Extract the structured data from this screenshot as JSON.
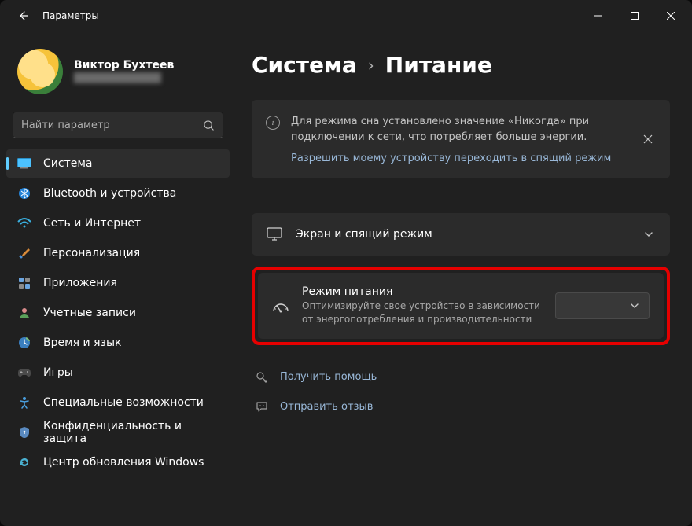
{
  "window": {
    "title": "Параметры"
  },
  "profile": {
    "name": "Виктор Бухтеев",
    "email": "████████████"
  },
  "search": {
    "placeholder": "Найти параметр"
  },
  "sidebar": {
    "items": [
      {
        "label": "Система",
        "icon": "system"
      },
      {
        "label": "Bluetooth и устройства",
        "icon": "bluetooth"
      },
      {
        "label": "Сеть и Интернет",
        "icon": "wifi"
      },
      {
        "label": "Персонализация",
        "icon": "brush"
      },
      {
        "label": "Приложения",
        "icon": "apps"
      },
      {
        "label": "Учетные записи",
        "icon": "account"
      },
      {
        "label": "Время и язык",
        "icon": "time"
      },
      {
        "label": "Игры",
        "icon": "gaming"
      },
      {
        "label": "Специальные возможности",
        "icon": "accessibility"
      },
      {
        "label": "Конфиденциальность и защита",
        "icon": "privacy"
      },
      {
        "label": "Центр обновления Windows",
        "icon": "update"
      }
    ],
    "active_index": 0
  },
  "breadcrumb": {
    "parent": "Система",
    "current": "Питание"
  },
  "info_banner": {
    "text": "Для режима сна установлено значение «Никогда» при подключении к сети, что потребляет больше энергии.",
    "link": "Разрешить моему устройству переходить в спящий режим"
  },
  "screen_sleep": {
    "title": "Экран и спящий режим"
  },
  "power_mode": {
    "title": "Режим питания",
    "description": "Оптимизируйте свое устройство в зависимости от энергопотребления и производительности",
    "selected": ""
  },
  "footer_links": {
    "help": "Получить помощь",
    "feedback": "Отправить отзыв"
  }
}
